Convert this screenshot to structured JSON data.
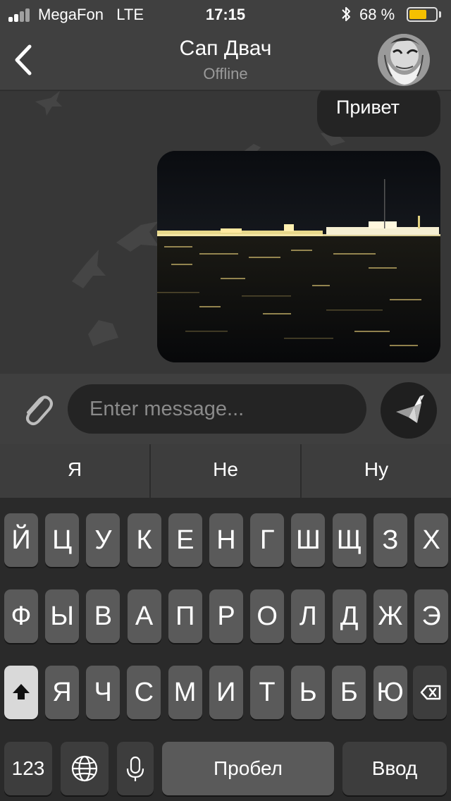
{
  "status_bar": {
    "carrier": "MegaFon",
    "network": "LTE",
    "time": "17:15",
    "battery_percent": "68 %",
    "battery_level": 0.68,
    "icons": [
      "signal-icon",
      "bluetooth-icon",
      "battery-icon"
    ]
  },
  "header": {
    "title": "Сап Двач",
    "status": "Offline",
    "back_icon": "chevron-left-icon"
  },
  "messages": [
    {
      "type": "text",
      "text": "Привет"
    },
    {
      "type": "photo"
    }
  ],
  "composer": {
    "placeholder": "Enter message...",
    "attach_icon": "paperclip-icon",
    "send_icon": "bird-send-icon"
  },
  "suggestions": [
    "Я",
    "Не",
    "Ну"
  ],
  "keyboard": {
    "row1": [
      "Й",
      "Ц",
      "У",
      "К",
      "Е",
      "Н",
      "Г",
      "Ш",
      "Щ",
      "З",
      "Х"
    ],
    "row2": [
      "Ф",
      "Ы",
      "В",
      "А",
      "П",
      "Р",
      "О",
      "Л",
      "Д",
      "Ж",
      "Э"
    ],
    "row3": [
      "Я",
      "Ч",
      "С",
      "М",
      "И",
      "Т",
      "Ь",
      "Б",
      "Ю"
    ],
    "numbers_label": "123",
    "space_label": "Пробел",
    "return_label": "Ввод",
    "icons": [
      "shift-icon",
      "backspace-icon",
      "globe-icon",
      "microphone-icon"
    ]
  },
  "colors": {
    "battery": "#f5c000",
    "bubble": "#242424",
    "keyboard_bg": "#2a2a2a",
    "key": "#5a5a5a"
  }
}
